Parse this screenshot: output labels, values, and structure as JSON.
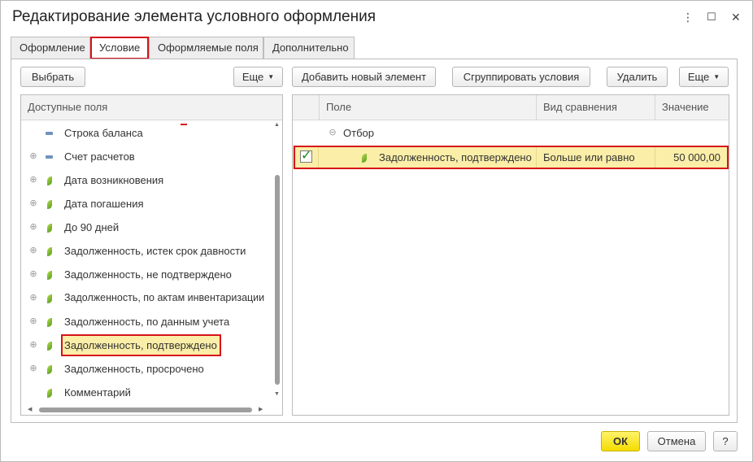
{
  "window": {
    "title": "Редактирование элемента условного оформления",
    "controls": {
      "more": "⋮",
      "maximize": "☐",
      "close": "✕"
    }
  },
  "tabs": [
    {
      "label": "Оформление"
    },
    {
      "label": "Условие"
    },
    {
      "label": "Оформляемые поля"
    },
    {
      "label": "Дополнительно"
    }
  ],
  "left": {
    "choose_label": "Выбрать",
    "more_label": "Еще",
    "header": "Доступные поля",
    "items": [
      {
        "label": "Строка баланса",
        "icon": "dash-icon",
        "expandable": false
      },
      {
        "label": "Счет расчетов",
        "icon": "dash-icon",
        "expandable": true
      },
      {
        "label": "Дата возникновения",
        "icon": "leaf-icon",
        "expandable": true
      },
      {
        "label": "Дата погашения",
        "icon": "leaf-icon",
        "expandable": true
      },
      {
        "label": "До 90 дней",
        "icon": "leaf-icon",
        "expandable": true
      },
      {
        "label": "Задолженность, истек срок давности",
        "icon": "leaf-icon",
        "expandable": true
      },
      {
        "label": "Задолженность, не подтверждено",
        "icon": "leaf-icon",
        "expandable": true
      },
      {
        "label": "Задолженность, по актам инвентаризации",
        "icon": "leaf-icon",
        "expandable": true
      },
      {
        "label": "Задолженность, по данным учета",
        "icon": "leaf-icon",
        "expandable": true
      },
      {
        "label": "Задолженность, подтверждено",
        "icon": "leaf-icon",
        "expandable": true
      },
      {
        "label": "Задолженность, просрочено",
        "icon": "leaf-icon",
        "expandable": true
      },
      {
        "label": "Комментарий",
        "icon": "leaf-icon",
        "expandable": false
      }
    ]
  },
  "right": {
    "add_label": "Добавить новый элемент",
    "group_label": "Сгруппировать условия",
    "delete_label": "Удалить",
    "more_label": "Еще",
    "columns": {
      "field": "Поле",
      "comparison": "Вид сравнения",
      "value": "Значение"
    },
    "group_label_row": "Отбор",
    "condition": {
      "field": "Задолженность, подтверждено",
      "comparison": "Больше или равно",
      "value": "50 000,00",
      "checked": true
    }
  },
  "footer": {
    "ok_label": "ОК",
    "cancel_label": "Отмена",
    "help_label": "?"
  },
  "colors": {
    "highlight_red": "#d6141a",
    "selection_yellow": "#fbeea8",
    "ok_yellow": "#f5dc00",
    "leaf_green": "#6fb12b"
  }
}
